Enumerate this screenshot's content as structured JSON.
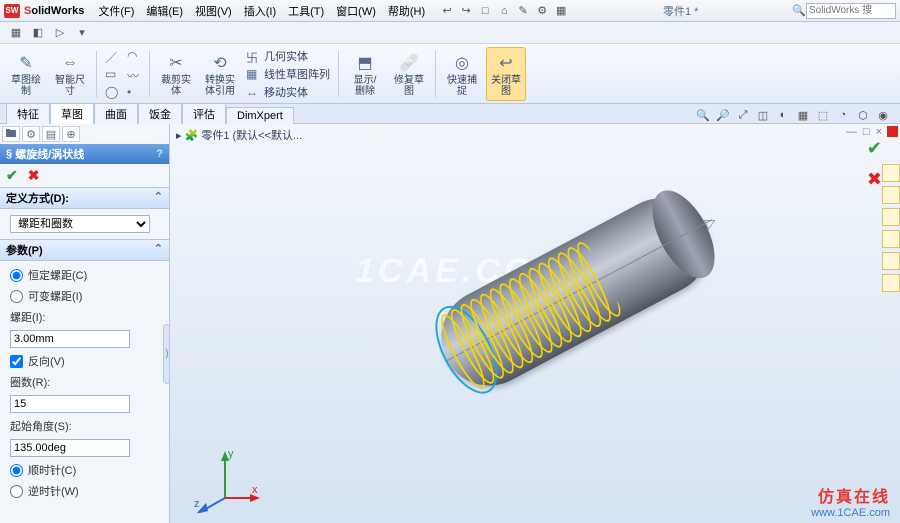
{
  "app": {
    "logo_text": "SW",
    "name_s": "S",
    "name_rest": "olidWorks",
    "search_placeholder": "SolidWorks 搜"
  },
  "menus": [
    "文件(F)",
    "编辑(E)",
    "视图(V)",
    "插入(I)",
    "工具(T)",
    "窗口(W)",
    "帮助(H)"
  ],
  "title_doc": "零件1 *",
  "qa_icons": [
    "↩",
    "↪",
    "□",
    "⌂",
    "✎",
    "⚙",
    "▦"
  ],
  "quickbar_icons": [
    "▦",
    "◧",
    "▷",
    "▾"
  ],
  "ribbon": {
    "sketch": "草图绘\n制",
    "smart_dim": "智能尺\n寸",
    "trim": "裁剪实\n体",
    "convert": "转换实\n体引用",
    "group_items": [
      "几何实体",
      "线性草图阵列",
      "移动实体"
    ],
    "display": "显示/\n删除",
    "repair": "修复草\n图",
    "quick_snap": "快速捕\n捉",
    "close_sketch": "关闭草\n图"
  },
  "cm_tabs": [
    "特征",
    "草图",
    "曲面",
    "饭金",
    "评估",
    "DimXpert"
  ],
  "heads_icons": [
    "🔍",
    "🔎",
    "⤢",
    "◫",
    "◐",
    "▦",
    "⬚",
    "◔",
    "⬡",
    "◉"
  ],
  "document_name": "零件1 (默认<<默认...",
  "panel": {
    "title": "螺旋线/涡状线",
    "help": "?",
    "def_group": "定义方式(D):",
    "def_option": "螺距和圈数",
    "params_group": "参数(P)",
    "r_const": "恒定螺距(C)",
    "r_var": "可变螺距(I)",
    "lbl_pitch": "螺距(I):",
    "val_pitch": "3.00mm",
    "chk_reverse": "反向(V)",
    "lbl_rev": "圈数(R):",
    "val_rev": "15",
    "lbl_angle": "起始角度(S):",
    "val_angle": "135.00deg",
    "r_cw": "顺时针(C)",
    "r_ccw": "逆时针(W)"
  },
  "triad": {
    "x": "x",
    "y": "y",
    "z": "z"
  },
  "watermark": "1CAE.COM",
  "wm_brand": "仿真在线",
  "wm_url": "www.1CAE.com"
}
